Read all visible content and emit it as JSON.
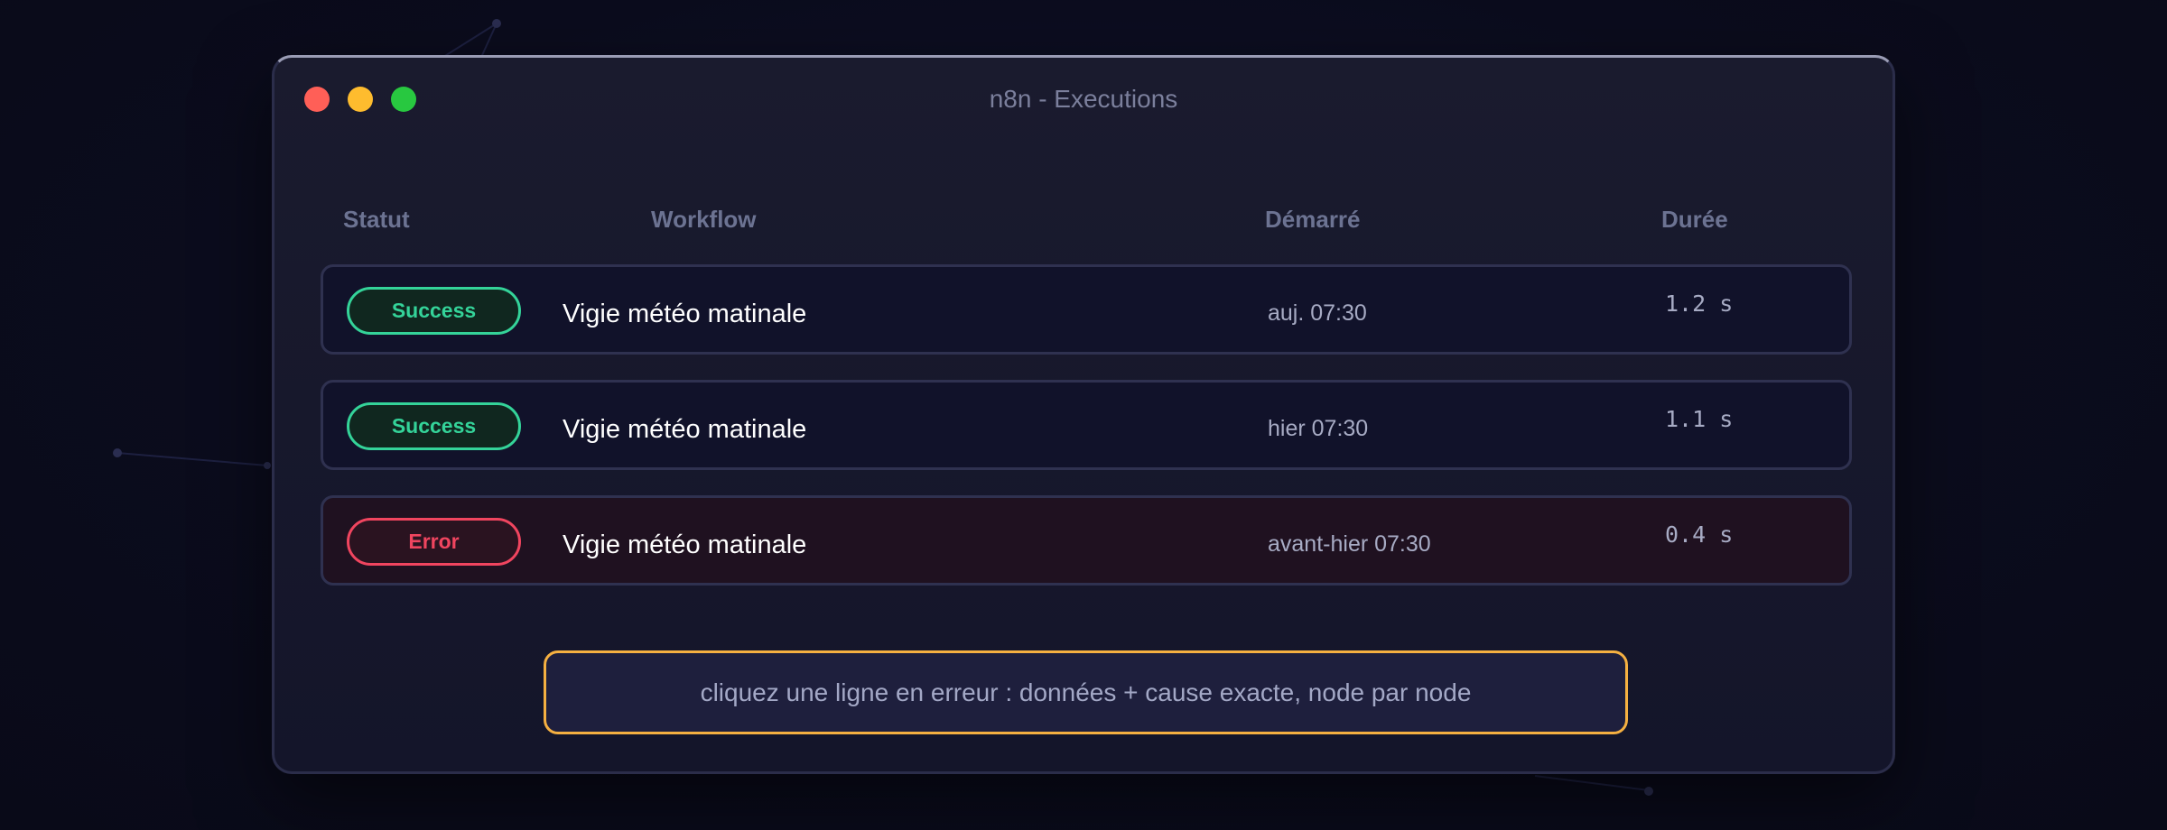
{
  "window": {
    "title": "n8n - Executions"
  },
  "table": {
    "headers": {
      "status": "Statut",
      "workflow": "Workflow",
      "started": "Démarré",
      "duration": "Durée"
    },
    "rows": [
      {
        "status": "Success",
        "workflow": "Vigie météo matinale",
        "started": "auj. 07:30",
        "duration": "1.2 s"
      },
      {
        "status": "Success",
        "workflow": "Vigie météo matinale",
        "started": "hier 07:30",
        "duration": "1.1 s"
      },
      {
        "status": "Error",
        "workflow": "Vigie météo matinale",
        "started": "avant-hier 07:30",
        "duration": "0.4 s"
      }
    ]
  },
  "hint": {
    "text": "cliquez une ligne en erreur : données + cause exacte, node par node"
  },
  "colors": {
    "success": "#34d399",
    "error": "#f0455f",
    "hint_border": "#f5b041"
  }
}
